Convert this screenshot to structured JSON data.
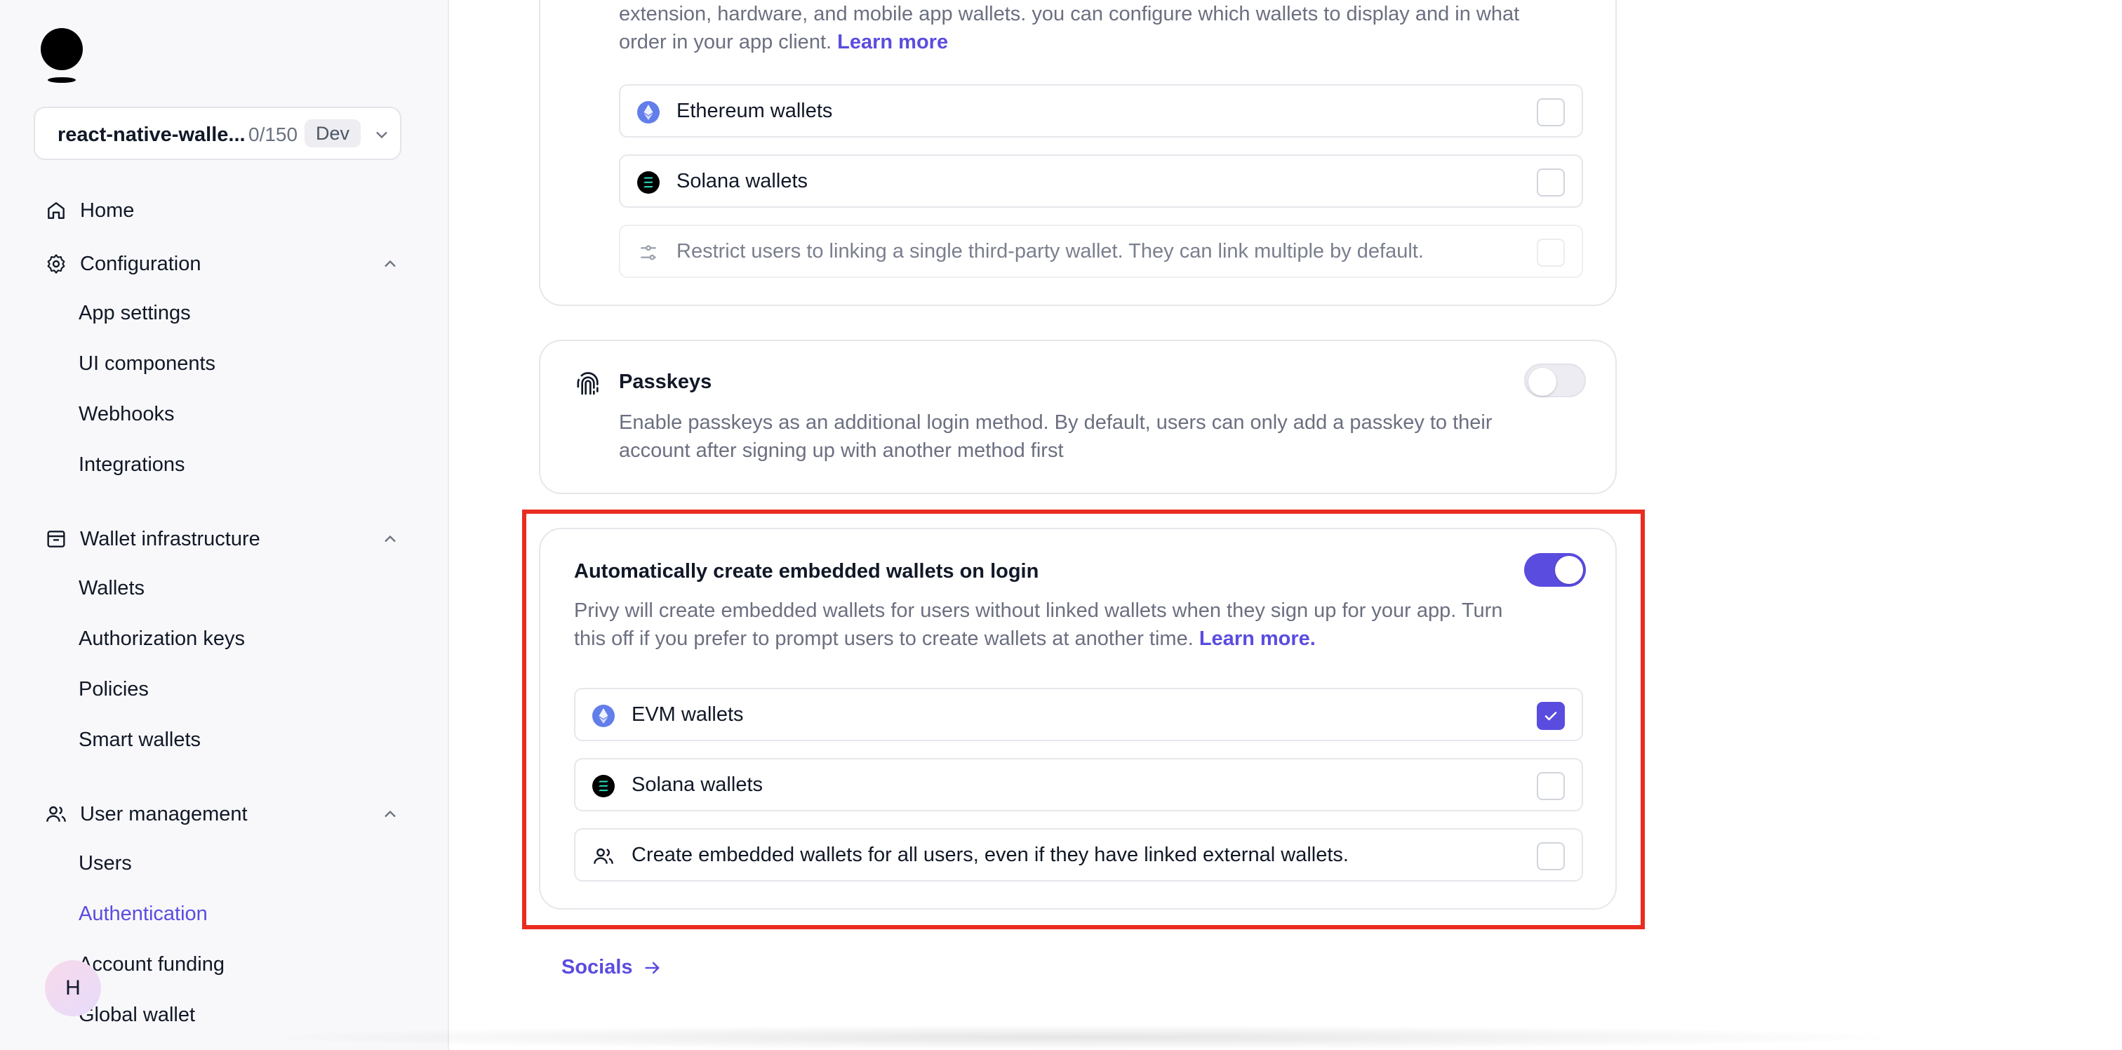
{
  "sidebar": {
    "app": {
      "name": "react-native-walle...",
      "count": "0/150",
      "env": "Dev"
    },
    "home": "Home",
    "configuration": {
      "label": "Configuration",
      "items": [
        "App settings",
        "UI components",
        "Webhooks",
        "Integrations"
      ]
    },
    "wallet_infra": {
      "label": "Wallet infrastructure",
      "items": [
        "Wallets",
        "Authorization keys",
        "Policies",
        "Smart wallets"
      ]
    },
    "user_mgmt": {
      "label": "User management",
      "items": [
        "Users",
        "Authentication",
        "Account funding",
        "Global wallet"
      ]
    },
    "avatar_initial": "H"
  },
  "external_wallets": {
    "desc_line1": "extension, hardware, and mobile app wallets. you can configure which wallets to display and in what",
    "desc_line2": "order in your app client.",
    "learn_more": "Learn more",
    "rows": [
      {
        "label": "Ethereum wallets",
        "checked": false,
        "icon": "ethereum-icon"
      },
      {
        "label": "Solana wallets",
        "checked": false,
        "icon": "solana-icon"
      },
      {
        "label": "Restrict users to linking a single third-party wallet. They can link multiple by default.",
        "checked": false,
        "icon": "sliders-icon"
      }
    ]
  },
  "passkeys": {
    "title": "Passkeys",
    "desc_line1": "Enable passkeys as an additional login method. By default, users can only add a passkey to their",
    "desc_line2": "account after signing up with another method first",
    "enabled": false
  },
  "embedded": {
    "title": "Automatically create embedded wallets on login",
    "desc_line1": "Privy will create embedded wallets for users without linked wallets when they sign up for your app. Turn",
    "desc_line2": "this off if you prefer to prompt users to create wallets at another time.",
    "learn_more": "Learn more.",
    "enabled": true,
    "rows": [
      {
        "label": "EVM wallets",
        "checked": true,
        "icon": "ethereum-icon"
      },
      {
        "label": "Solana wallets",
        "checked": false,
        "icon": "solana-icon"
      },
      {
        "label": "Create embedded wallets for all users, even if they have linked external wallets.",
        "checked": false,
        "icon": "users-icon"
      }
    ]
  },
  "footer_link": "Socials",
  "colors": {
    "accent": "#5b4ce0",
    "highlight": "#ea2b1f"
  }
}
